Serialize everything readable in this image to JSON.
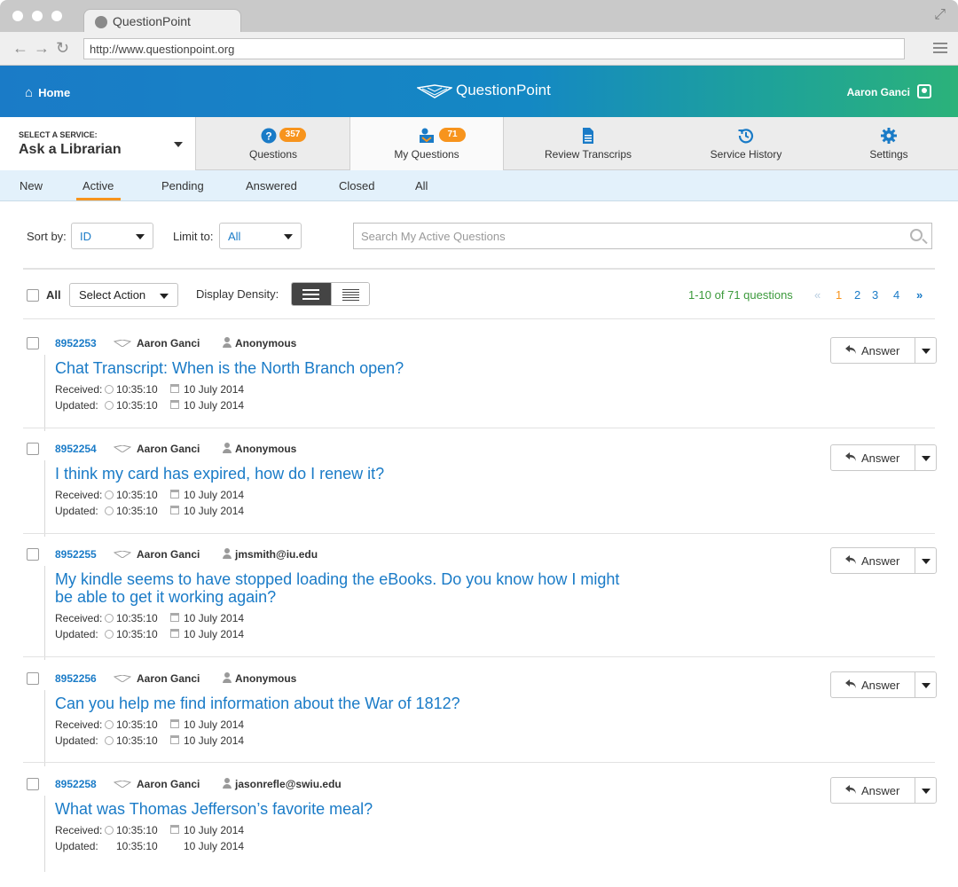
{
  "browser": {
    "tab_title": "QuestionPoint",
    "url": "http://www.questionpoint.org"
  },
  "header": {
    "home_label": "Home",
    "logo_text": "QuestionPoint",
    "user_name": "Aaron Ganci"
  },
  "service": {
    "caption": "SELECT A SERVICE:",
    "name": "Ask a Librarian"
  },
  "nav": {
    "items": [
      {
        "label": "Questions",
        "badge": "357",
        "icon": "question-circle-icon"
      },
      {
        "label": "My Questions",
        "badge": "71",
        "icon": "inbox-user-icon"
      },
      {
        "label": "Review Transcrips",
        "icon": "document-icon"
      },
      {
        "label": "Service History",
        "icon": "history-icon"
      },
      {
        "label": "Settings",
        "icon": "gear-icon"
      }
    ]
  },
  "status_tabs": [
    "New",
    "Active",
    "Pending",
    "Answered",
    "Closed",
    "All"
  ],
  "active_status_tab": "Active",
  "filters": {
    "sort_label": "Sort by:",
    "sort_value": "ID",
    "limit_label": "Limit to:",
    "limit_value": "All",
    "search_placeholder": "Search My Active Questions"
  },
  "toolbar": {
    "all_label": "All",
    "action_label": "Select Action",
    "density_label": "Display Density:",
    "result_count": "1-10 of 71 questions",
    "pager": {
      "first": "«",
      "pages": [
        "1",
        "2",
        "3",
        "4"
      ],
      "current": "1",
      "next": "»"
    }
  },
  "questions": [
    {
      "id": "8952253",
      "librarian": "Aaron Ganci",
      "patron": "Anonymous",
      "title": "Chat Transcript: When is the North Branch open?",
      "received_label": "Received:",
      "received_time": "10:35:10",
      "received_date": "10 July 2014",
      "updated_label": "Updated:",
      "updated_time": "10:35:10",
      "updated_date": "10 July 2014",
      "answer_label": "Answer"
    },
    {
      "id": "8952254",
      "librarian": "Aaron Ganci",
      "patron": "Anonymous",
      "title": "I think my card has expired, how do I renew it?",
      "received_label": "Received:",
      "received_time": "10:35:10",
      "received_date": "10 July 2014",
      "updated_label": "Updated:",
      "updated_time": "10:35:10",
      "updated_date": "10 July 2014",
      "answer_label": "Answer"
    },
    {
      "id": "8952255",
      "librarian": "Aaron Ganci",
      "patron": "jmsmith@iu.edu",
      "title": "My kindle seems to have stopped loading the eBooks. Do you know how I might be able to get it working again?",
      "received_label": "Received:",
      "received_time": "10:35:10",
      "received_date": "10 July 2014",
      "updated_label": "Updated:",
      "updated_time": "10:35:10",
      "updated_date": "10 July 2014",
      "answer_label": "Answer"
    },
    {
      "id": "8952256",
      "librarian": "Aaron Ganci",
      "patron": "Anonymous",
      "title": "Can you help me find information about the War of 1812?",
      "received_label": "Received:",
      "received_time": "10:35:10",
      "received_date": "10 July 2014",
      "updated_label": "Updated:",
      "updated_time": "10:35:10",
      "updated_date": "10 July 2014",
      "answer_label": "Answer"
    },
    {
      "id": "8952258",
      "librarian": "Aaron Ganci",
      "patron": "jasonrefle@swiu.edu",
      "title": "What was Thomas Jefferson’s favorite meal?",
      "received_label": "Received:",
      "received_time": "10:35:10",
      "received_date": "10 July 2014",
      "updated_label": "Updated:",
      "updated_time": "10:35:10",
      "updated_date": "10 July 2014",
      "answer_label": "Answer"
    }
  ],
  "colors": {
    "accent": "#1a7bc7",
    "badge": "#f7941d",
    "tab_underline": "#f7941d",
    "result_count": "#3c9a3c"
  }
}
